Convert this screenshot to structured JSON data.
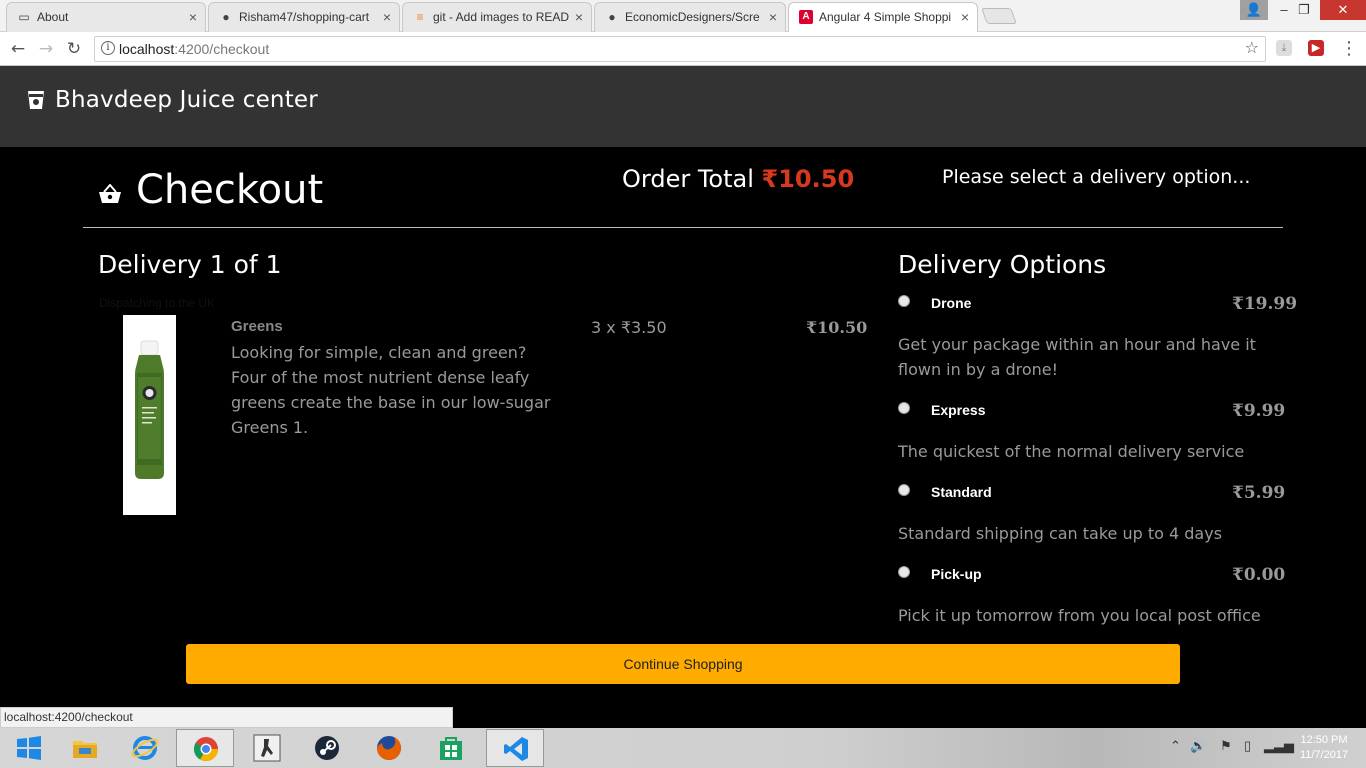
{
  "browser": {
    "tabs": [
      {
        "title": "About",
        "icon": "page-icon"
      },
      {
        "title": "Risham47/shopping-cart",
        "icon": "github-icon"
      },
      {
        "title": "git - Add images to READ",
        "icon": "stackoverflow-icon"
      },
      {
        "title": "EconomicDesigners/Scre",
        "icon": "github-icon"
      },
      {
        "title": "Angular 4 Simple Shoppi",
        "icon": "angular-icon"
      }
    ],
    "url_host": "localhost",
    "url_path": ":4200/checkout",
    "status_url": "localhost:4200/checkout"
  },
  "header": {
    "brand": "Bhavdeep Juice center",
    "brand_icon": "cup-icon"
  },
  "checkout": {
    "title": "Checkout",
    "order_total_label": "Order Total",
    "order_total_value": "₹10.50",
    "delivery_prompt": "Please select a delivery option...",
    "accent_color": "#d9381e"
  },
  "delivery": {
    "heading": "Delivery 1 of 1",
    "dispatch_note": "Dispatching to the UK",
    "item": {
      "name": "Greens",
      "description": "Looking for simple, clean and green? Four of the most nutrient dense leafy greens create the base in our low-sugar Greens 1.",
      "quantity_price": "3 x ₹3.50",
      "line_total": "₹10.50"
    }
  },
  "delivery_options": {
    "heading": "Delivery Options",
    "options": [
      {
        "name": "Drone",
        "price": "₹19.99",
        "description": "Get your package within an hour and have it flown in by a drone!"
      },
      {
        "name": "Express",
        "price": "₹9.99",
        "description": "The quickest of the normal delivery service"
      },
      {
        "name": "Standard",
        "price": "₹5.99",
        "description": "Standard shipping can take up to 4 days"
      },
      {
        "name": "Pick-up",
        "price": "₹0.00",
        "description": "Pick it up tomorrow from you local post office"
      }
    ]
  },
  "actions": {
    "continue_label": "Continue Shopping",
    "button_color": "#ffab00"
  },
  "taskbar": {
    "time": "12:50 PM",
    "date": "11/7/2017",
    "apps": [
      "windows-start",
      "file-explorer",
      "internet-explorer",
      "chrome",
      "counter-strike",
      "steam",
      "firefox",
      "store",
      "visual-studio-code"
    ]
  }
}
